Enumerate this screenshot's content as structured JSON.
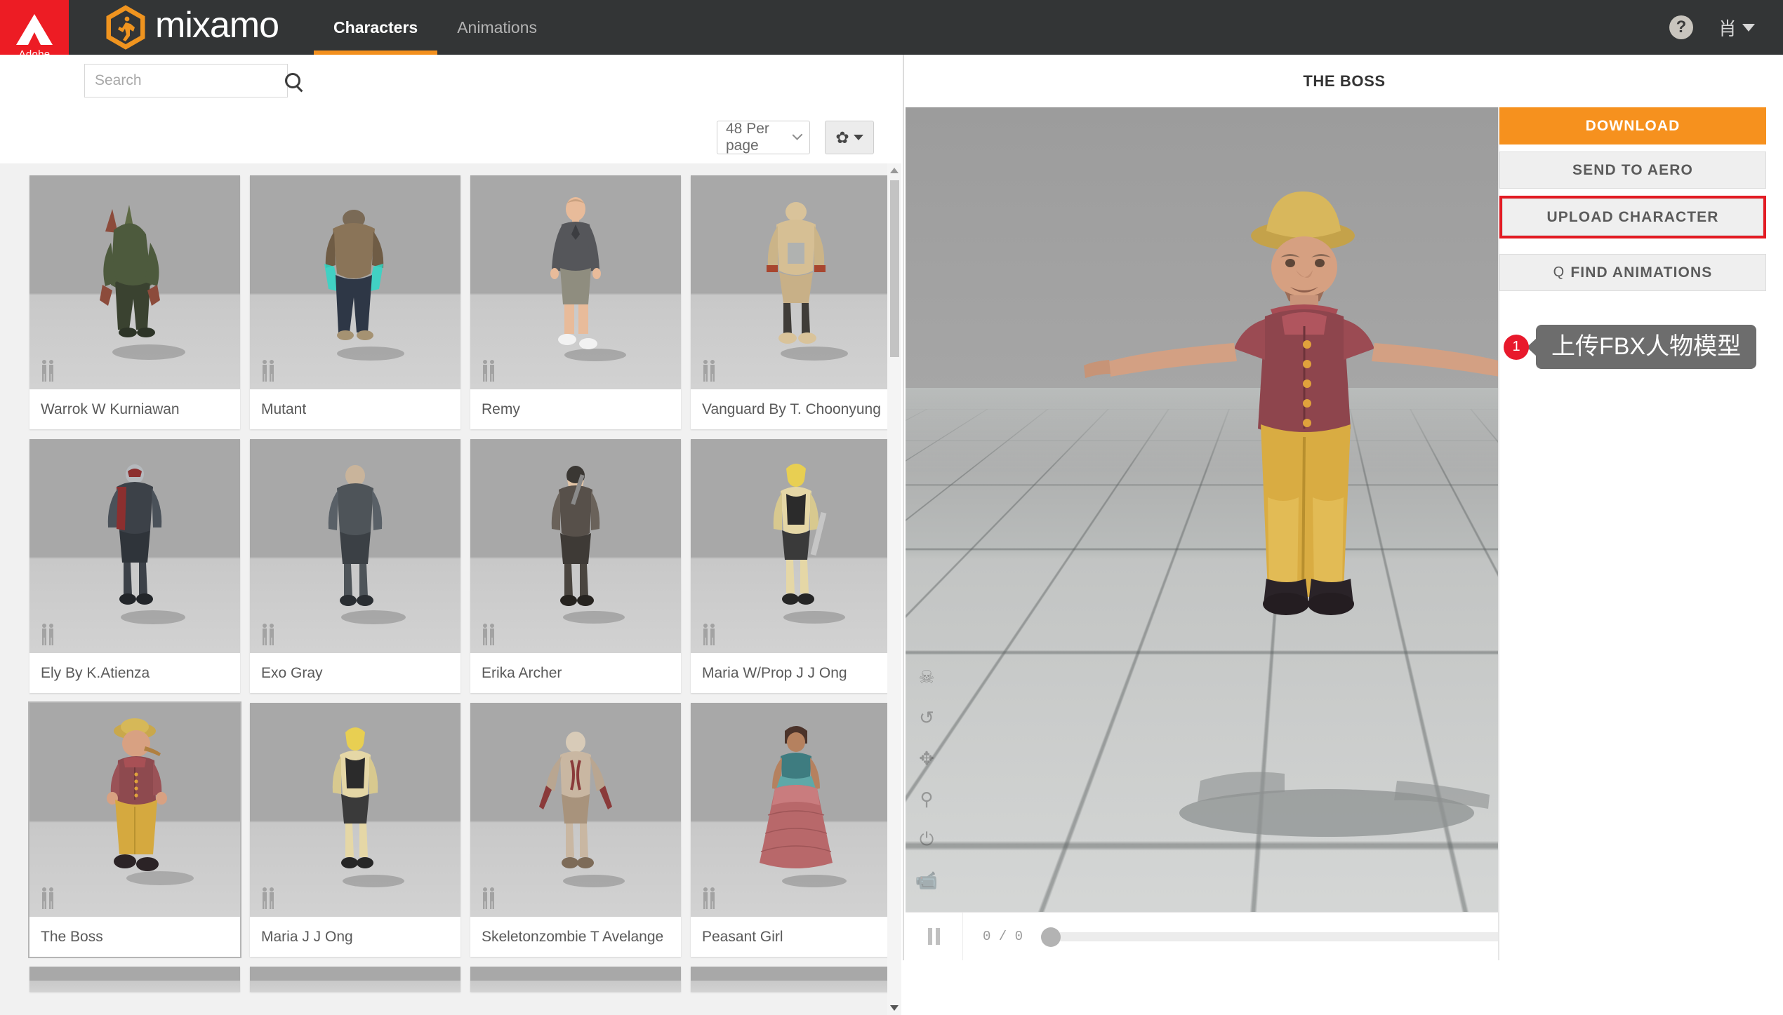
{
  "topbar": {
    "adobe_label": "Adobe",
    "brand": "mixamo",
    "logo_icon": "mixamo-hex-runner-icon",
    "nav": [
      {
        "label": "Characters",
        "active": true
      },
      {
        "label": "Animations",
        "active": false
      }
    ],
    "help_icon": "question-mark-icon",
    "help_label": "?",
    "user_name": "肖",
    "user_caret_icon": "chevron-down-icon"
  },
  "toolbar": {
    "search_value": "",
    "search_placeholder": "Search",
    "search_icon": "search-icon",
    "per_page_label": "48 Per page",
    "per_page_caret_icon": "chevron-down-icon",
    "gear_icon": "gear-icon",
    "gear_glyph": "✿",
    "gear_caret_icon": "caret-down-icon"
  },
  "grid": {
    "scale_badge_icon": "two-person-scale-icon",
    "cards": [
      {
        "name": "Warrok W Kurniawan",
        "selected": false
      },
      {
        "name": "Mutant",
        "selected": false
      },
      {
        "name": "Remy",
        "selected": false
      },
      {
        "name": "Vanguard By T. Choonyung",
        "selected": false
      },
      {
        "name": "Ely By K.Atienza",
        "selected": false
      },
      {
        "name": "Exo Gray",
        "selected": false
      },
      {
        "name": "Erika Archer",
        "selected": false
      },
      {
        "name": "Maria W/Prop J J Ong",
        "selected": false
      },
      {
        "name": "The Boss",
        "selected": true
      },
      {
        "name": "Maria J J Ong",
        "selected": false
      },
      {
        "name": "Skeletonzombie T Avelange",
        "selected": false
      },
      {
        "name": "Peasant Girl",
        "selected": false
      }
    ]
  },
  "scrollbar": {
    "up_icon": "triangle-up-icon",
    "down_icon": "triangle-down-icon"
  },
  "viewer": {
    "title": "THE BOSS",
    "tools": [
      {
        "icon": "skeleton-skull-icon",
        "glyph": "☠"
      },
      {
        "icon": "reset-rotate-icon",
        "glyph": "↺"
      },
      {
        "icon": "pan-move-icon",
        "glyph": "✥"
      },
      {
        "icon": "zoom-icon",
        "glyph": "⚲"
      },
      {
        "icon": "power-toggle-icon",
        "glyph": "⏻"
      },
      {
        "icon": "camera-video-icon",
        "glyph": "📹"
      }
    ],
    "playback": {
      "pause_icon": "pause-icon",
      "frame_counter": "0 / 0",
      "progress_percent": 0
    }
  },
  "sidebar": {
    "download_label": "DOWNLOAD",
    "send_to_aero_label": "SEND TO AERO",
    "upload_character_label": "UPLOAD CHARACTER",
    "find_animations_label": "FIND ANIMATIONS",
    "find_animations_icon": "search-icon",
    "find_animations_glyph": "Q",
    "highlight_color": "#e31b23",
    "download_color": "#f6911e",
    "annotation": {
      "badge": "1",
      "text": "上传FBX人物模型"
    }
  }
}
